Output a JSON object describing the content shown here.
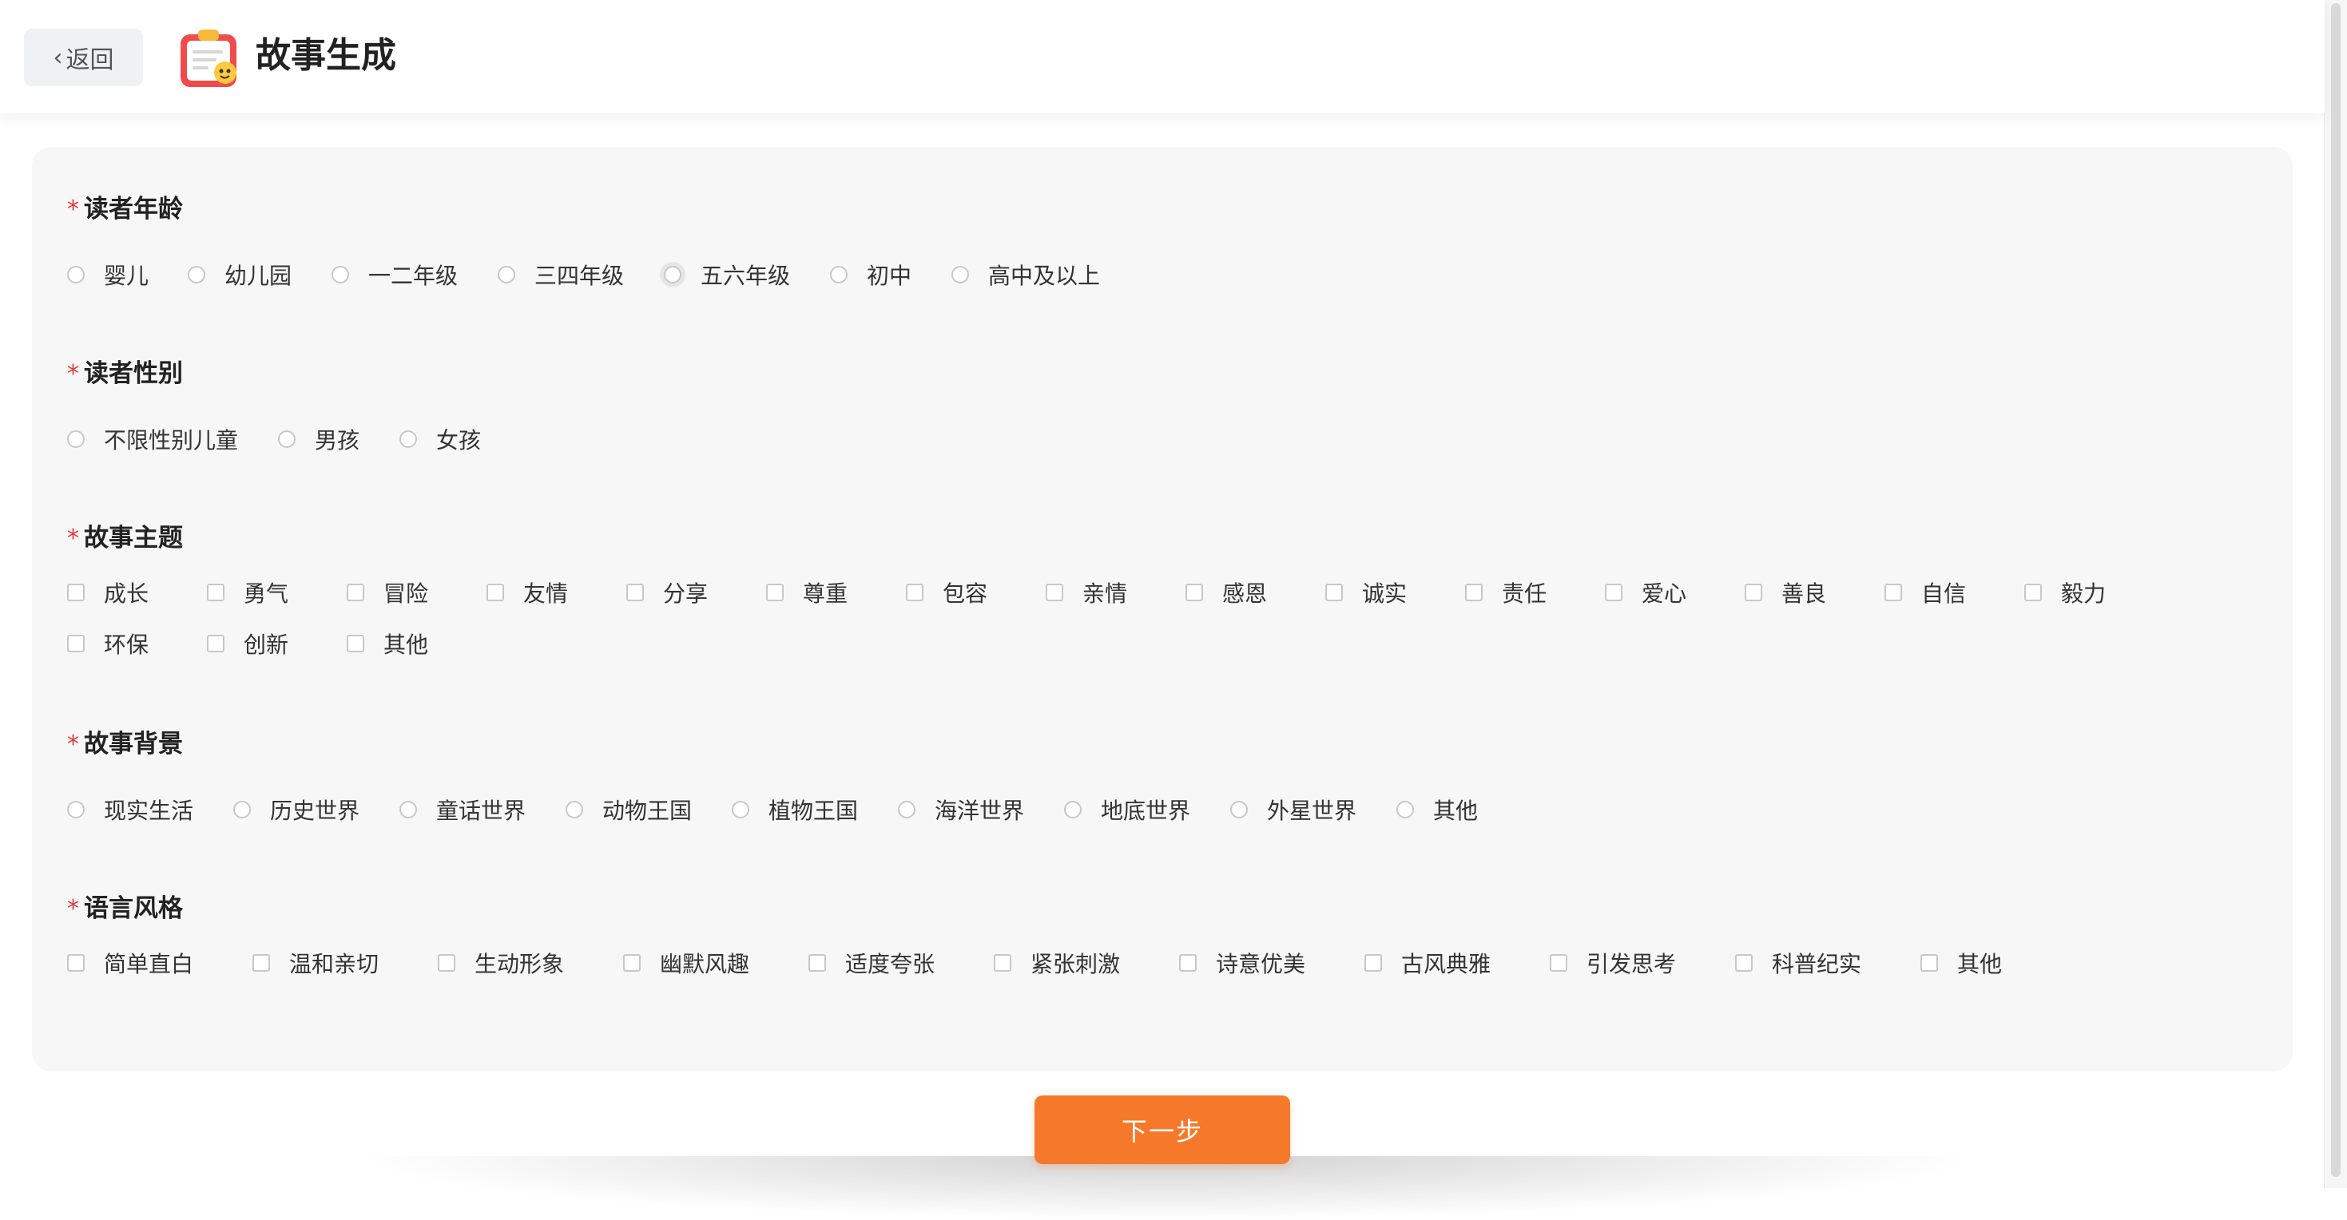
{
  "header": {
    "back_label": "返回",
    "title": "故事生成"
  },
  "sections": {
    "age": {
      "label": "读者年龄",
      "type": "radio",
      "options": [
        "婴儿",
        "幼儿园",
        "一二年级",
        "三四年级",
        "五六年级",
        "初中",
        "高中及以上"
      ]
    },
    "gender": {
      "label": "读者性别",
      "type": "radio",
      "options": [
        "不限性别儿童",
        "男孩",
        "女孩"
      ]
    },
    "theme": {
      "label": "故事主题",
      "type": "checkbox",
      "options": [
        "成长",
        "勇气",
        "冒险",
        "友情",
        "分享",
        "尊重",
        "包容",
        "亲情",
        "感恩",
        "诚实",
        "责任",
        "爱心",
        "善良",
        "自信",
        "毅力",
        "环保",
        "创新",
        "其他"
      ]
    },
    "setting": {
      "label": "故事背景",
      "type": "radio",
      "options": [
        "现实生活",
        "历史世界",
        "童话世界",
        "动物王国",
        "植物王国",
        "海洋世界",
        "地底世界",
        "外星世界",
        "其他"
      ]
    },
    "style": {
      "label": "语言风格",
      "type": "checkbox",
      "options": [
        "简单直白",
        "温和亲切",
        "生动形象",
        "幽默风趣",
        "适度夸张",
        "紧张刺激",
        "诗意优美",
        "古风典雅",
        "引发思考",
        "科普纪实",
        "其他"
      ]
    }
  },
  "next_label": "下一步",
  "colors": {
    "accent": "#f6792b",
    "required": "#e53935",
    "panel": "#f7f7f8"
  },
  "icons": {
    "back": "chevron-left-icon",
    "logo": "clipboard-story-icon"
  }
}
